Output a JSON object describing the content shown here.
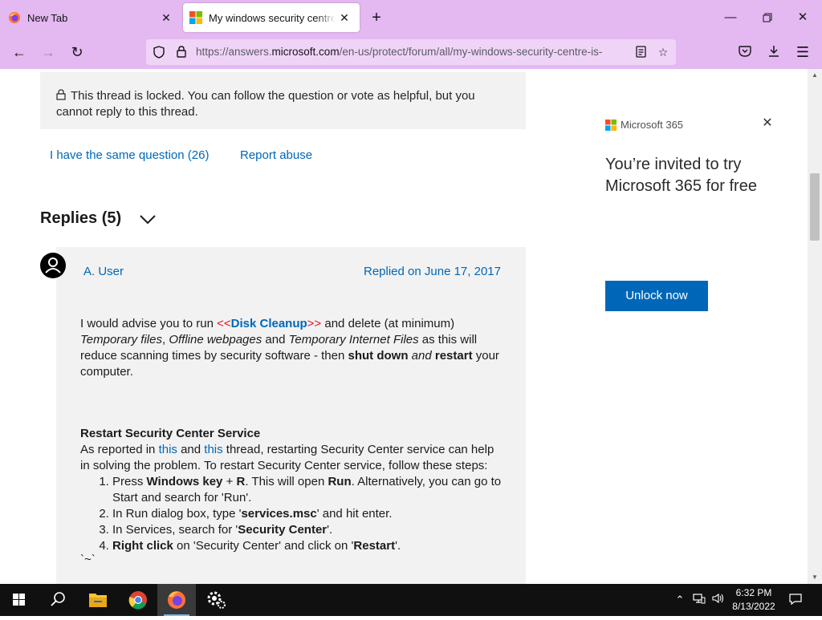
{
  "browser": {
    "tabs": [
      {
        "title": "New Tab",
        "active": false
      },
      {
        "title": "My windows security centre is not",
        "active": true
      }
    ],
    "new_tab_symbol": "+",
    "url_scheme_host_prefix": "https://answers.",
    "url_host": "microsoft.com",
    "url_path": "/en-us/protect/forum/all/my-windows-security-centre-is-",
    "colors": {
      "chrome": "#e4b8f0",
      "urlbar": "#f0d4f7"
    }
  },
  "thread": {
    "locked_notice": "This thread is locked. You can follow the question or vote as helpful, but you cannot reply to this thread.",
    "same_question": "I have the same question (26)",
    "report_abuse": "Report abuse",
    "replies_heading": "Replies (5)"
  },
  "reply": {
    "author": "A. User",
    "date": "Replied on June 17, 2017",
    "p1_a": "I would advise you to run ",
    "p1_lt": "<<",
    "p1_link": "Disk Cleanup",
    "p1_gt": ">>",
    "p1_b": " and delete (at minimum) ",
    "p1_i1": "Temporary files",
    "p1_c": ", ",
    "p1_i2": "Offline webpages",
    "p1_d": " and ",
    "p1_i3": "Temporary Internet Files",
    "p1_e": " as this will reduce scanning times by security software - then ",
    "p1_b1": "shut down",
    "p1_f": " ",
    "p1_i4": "and",
    "p1_g": " ",
    "p1_b2": "restart",
    "p1_h": " your computer.",
    "section_title": "Restart Security Center Service",
    "p2_a": "As reported in ",
    "p2_link1": "this",
    "p2_b": " and ",
    "p2_link2": "this",
    "p2_c": " thread, restarting Security Center service can help in solving the problem. To restart Security Center service, follow these steps:",
    "step1_a": "Press ",
    "step1_b": "Windows key",
    "step1_c": " + ",
    "step1_d": "R",
    "step1_e": ". This will open ",
    "step1_f": "Run",
    "step1_g": ". Alternatively, you can go to Start and search for 'Run'.",
    "step2_a": "In Run dialog box, type '",
    "step2_b": "services.msc",
    "step2_c": "' and hit enter.",
    "step3_a": "In Services, search for '",
    "step3_b": "Security Center",
    "step3_c": "'.",
    "step4_a": "Right click",
    "step4_b": " on 'Security Center' and click on '",
    "step4_c": "Restart",
    "step4_d": "'.",
    "trailing": "`~`"
  },
  "ad": {
    "brand": "Microsoft 365",
    "headline": "You’re invited to try Microsoft 365 for free",
    "cta": "Unlock now",
    "cta_color": "#0067b8"
  },
  "taskbar": {
    "time": "6:32 PM",
    "date": "8/13/2022",
    "apps": [
      "start-icon",
      "search-icon",
      "file-explorer-icon",
      "chrome-icon",
      "firefox-icon",
      "settings-icon"
    ]
  }
}
